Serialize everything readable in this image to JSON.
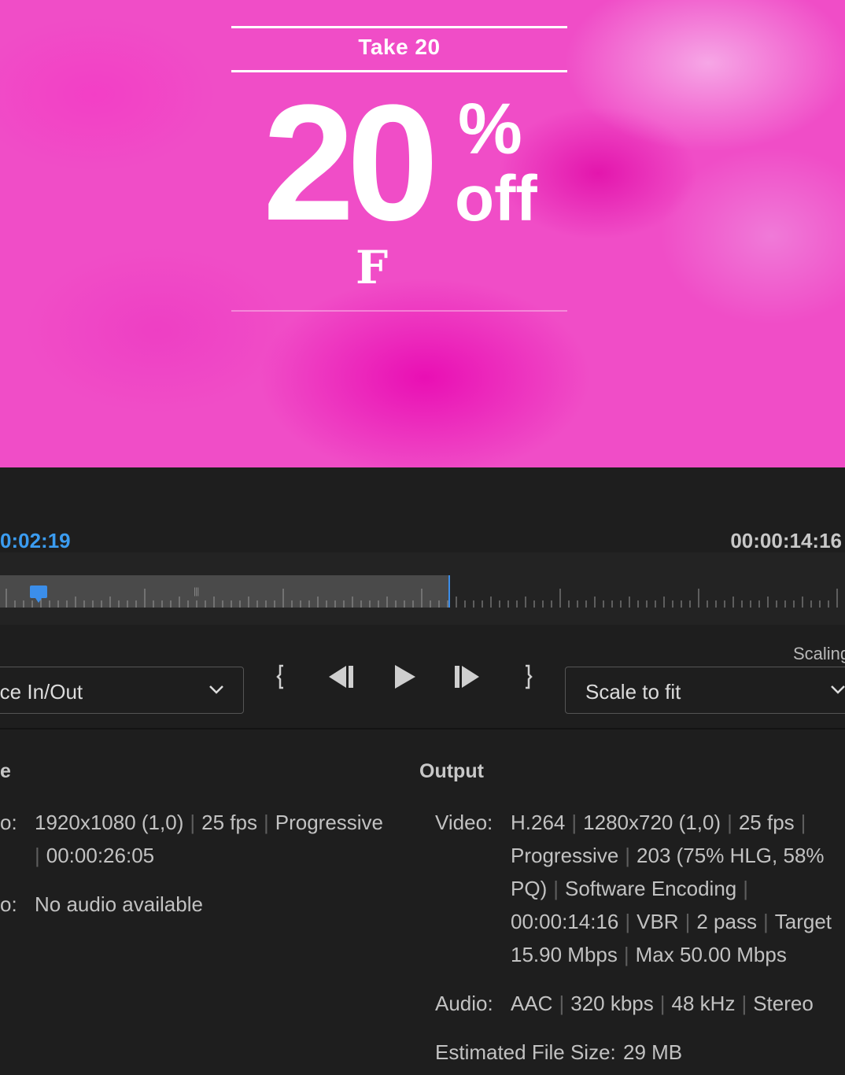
{
  "preview": {
    "headline": "Take 20",
    "big_number": "20",
    "percent": "%",
    "off": "off",
    "logo_letter": "F"
  },
  "timeline": {
    "current_time": "0:02:19",
    "duration": "00:00:14:16",
    "selection_fraction": 0.53,
    "in_point_fraction": 0.045
  },
  "controls": {
    "source_range": "rce In/Out",
    "scaling_label": "Scaling",
    "scaling_value": "Scale to fit",
    "buttons": [
      "set-in-point-icon",
      "step-back-icon",
      "play-icon",
      "step-forward-icon",
      "set-out-point-icon"
    ]
  },
  "source": {
    "header": "e",
    "video_label": "o:",
    "video_line1": [
      "1920x1080 (1,0)",
      "25 fps",
      "Progressive"
    ],
    "video_line2": "00:00:26:05",
    "audio_label": "o:",
    "audio_value": "No audio available"
  },
  "output": {
    "header": "Output",
    "video_label": "Video:",
    "video_lines": [
      [
        "H.264",
        "1280x720 (1,0)",
        "25 fps"
      ],
      [
        "Progressive",
        "203 (75% HLG, 58%"
      ],
      [
        "PQ)",
        "Software Encoding"
      ],
      [
        "00:00:14:16",
        "VBR",
        "2 pass",
        "Target"
      ],
      [
        "15.90 Mbps",
        "Max 50.00 Mbps"
      ]
    ],
    "audio_label": "Audio:",
    "audio_line": [
      "AAC",
      "320 kbps",
      "48 kHz",
      "Stereo"
    ],
    "size_label": "Estimated File Size:",
    "size_value": "29 MB"
  },
  "colors": {
    "accent_blue": "#3b8eea",
    "preview_pink": "#f04dc7",
    "panel_bg": "#1e1e1e"
  }
}
